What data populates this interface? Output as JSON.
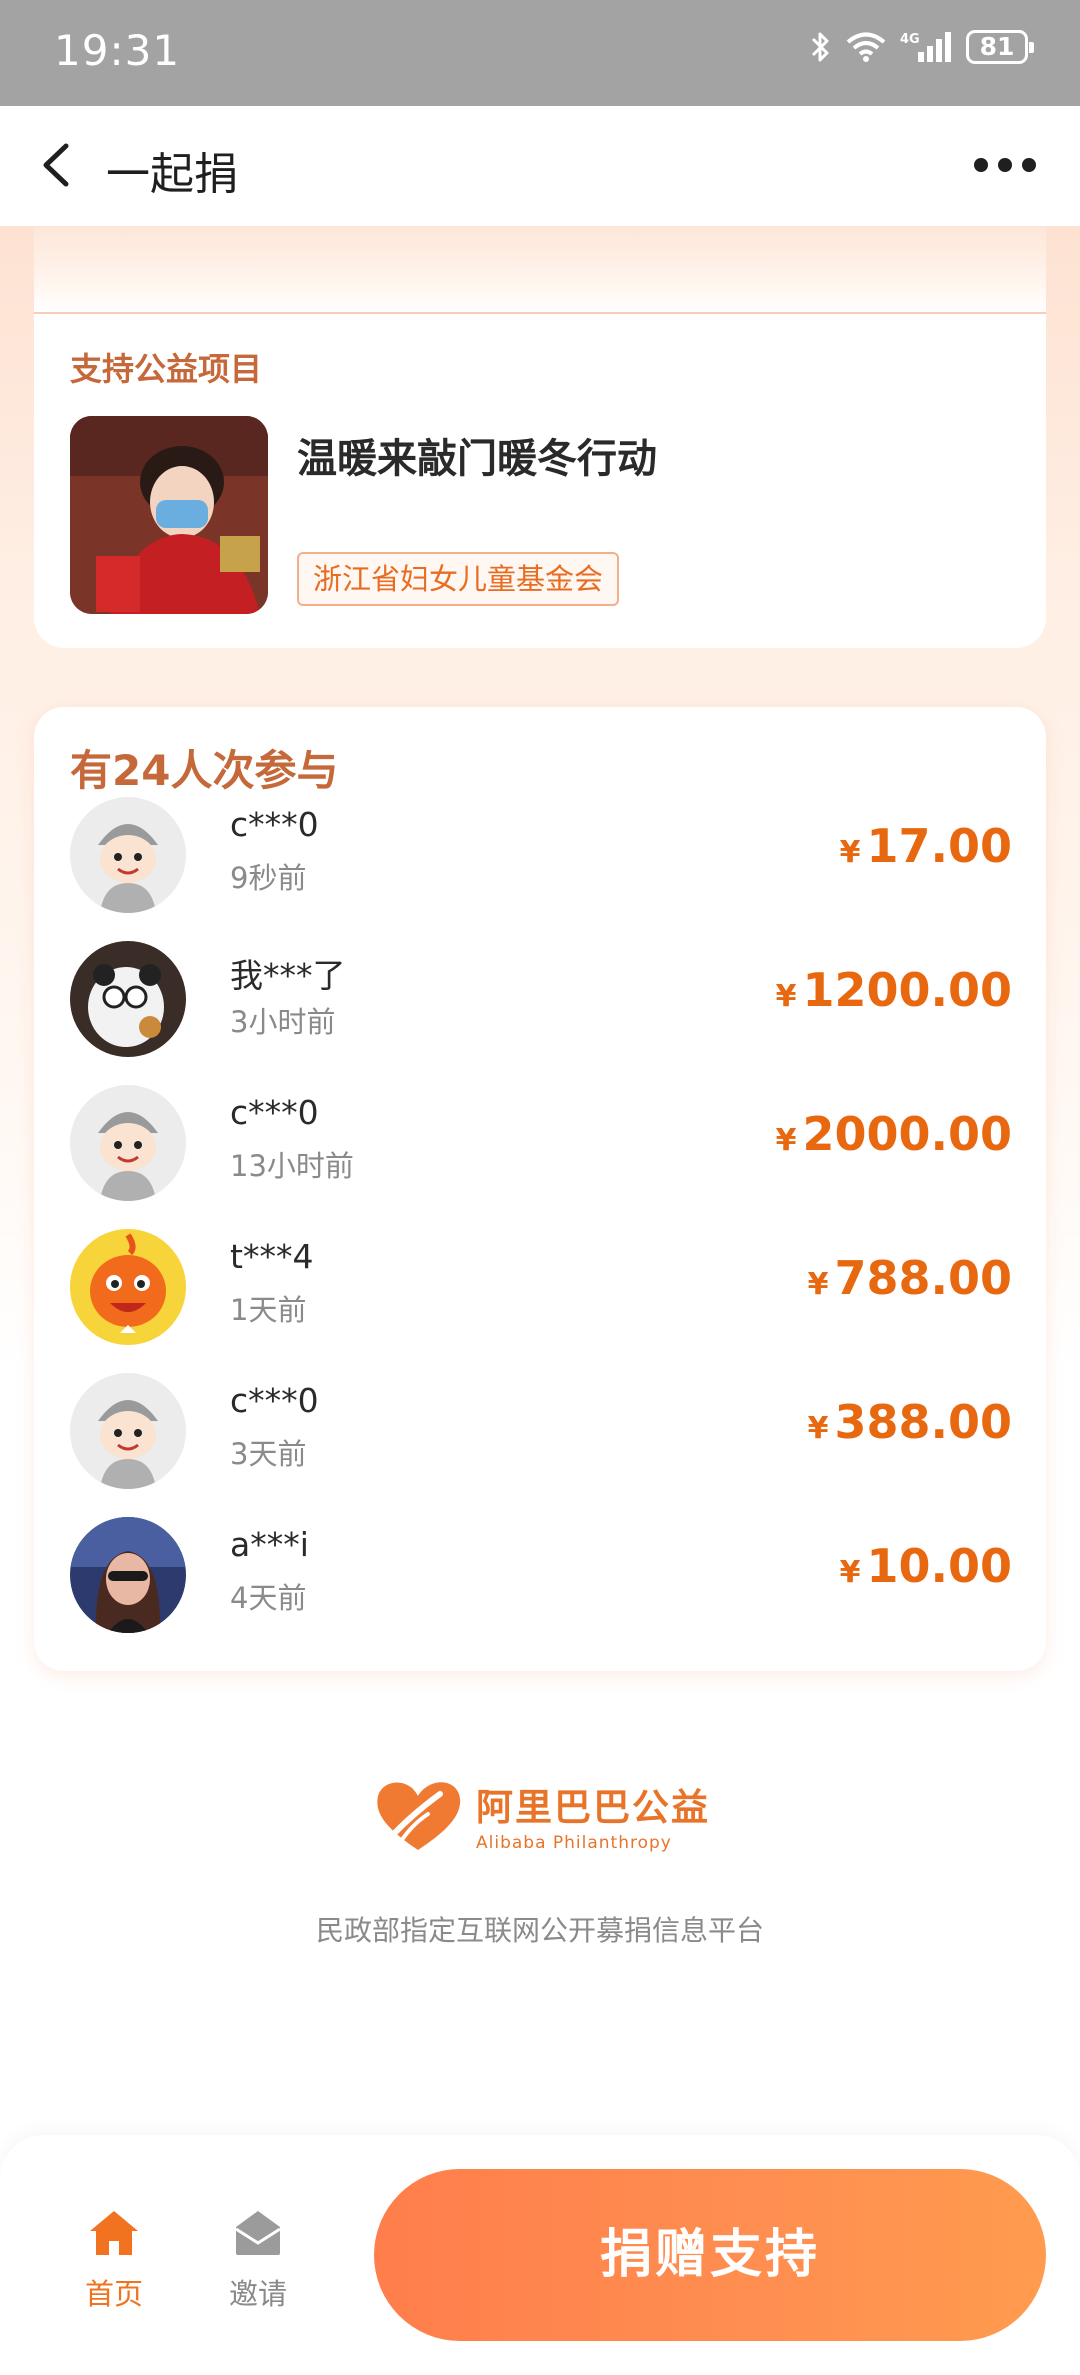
{
  "status_bar": {
    "time": "19:31",
    "battery": "81",
    "network": "4G"
  },
  "nav": {
    "title": "一起捐",
    "back_icon": "chevron-left-icon",
    "more_icon": "more-dots-icon"
  },
  "project": {
    "section_label": "支持公益项目",
    "title": "温暖来敲门暖冬行动",
    "organization": "浙江省妇女儿童基金会"
  },
  "participants": {
    "count_label": "有24人次参与",
    "currency": "¥",
    "donors": [
      {
        "name": "c***0",
        "time": "9秒前",
        "amount": "17.00",
        "avatar": "gray-mascot"
      },
      {
        "name": "我***了",
        "time": "3小时前",
        "amount": "1200.00",
        "avatar": "panda"
      },
      {
        "name": "c***0",
        "time": "13小时前",
        "amount": "2000.00",
        "avatar": "gray-mascot"
      },
      {
        "name": "t***4",
        "time": "1天前",
        "amount": "788.00",
        "avatar": "orange-mascot"
      },
      {
        "name": "c***0",
        "time": "3天前",
        "amount": "388.00",
        "avatar": "gray-mascot"
      },
      {
        "name": "a***i",
        "time": "4天前",
        "amount": "10.00",
        "avatar": "photo"
      }
    ]
  },
  "footer": {
    "logo_cn": "阿里巴巴公益",
    "logo_en": "Alibaba Philanthropy",
    "platform_text": "民政部指定互联网公开募捐信息平台"
  },
  "bottom_bar": {
    "home_label": "首页",
    "invite_label": "邀请",
    "donate_label": "捐赠支持"
  },
  "colors": {
    "accent": "#e8680f",
    "label_brown": "#c5683a",
    "button_start": "#ff7e4c",
    "button_end": "#ff9b4f"
  }
}
